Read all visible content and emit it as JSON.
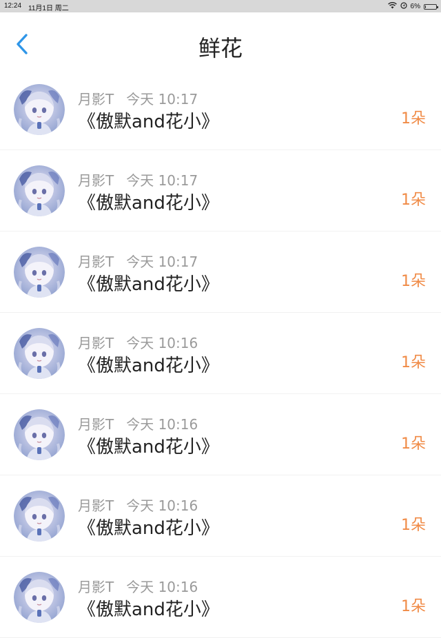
{
  "status_bar": {
    "time": "12:24",
    "date": "11月1日 周二",
    "battery": "6%",
    "battery_level": 0.06,
    "wifi_icon": "wifi-icon",
    "location_icon": "location-icon"
  },
  "nav": {
    "title": "鲜花",
    "back_icon": "chevron-left-icon",
    "accent": "#2f96e8"
  },
  "colors": {
    "count": "#f08a45",
    "meta": "#9a9a9a",
    "title": "#222222"
  },
  "records": [
    {
      "user": "月影T",
      "time": "今天 10:17",
      "title": "《傲默and花小》",
      "count": "1朵"
    },
    {
      "user": "月影T",
      "time": "今天 10:17",
      "title": "《傲默and花小》",
      "count": "1朵"
    },
    {
      "user": "月影T",
      "time": "今天 10:17",
      "title": "《傲默and花小》",
      "count": "1朵"
    },
    {
      "user": "月影T",
      "time": "今天 10:16",
      "title": "《傲默and花小》",
      "count": "1朵"
    },
    {
      "user": "月影T",
      "time": "今天 10:16",
      "title": "《傲默and花小》",
      "count": "1朵"
    },
    {
      "user": "月影T",
      "time": "今天 10:16",
      "title": "《傲默and花小》",
      "count": "1朵"
    },
    {
      "user": "月影T",
      "time": "今天 10:16",
      "title": "《傲默and花小》",
      "count": "1朵"
    }
  ]
}
